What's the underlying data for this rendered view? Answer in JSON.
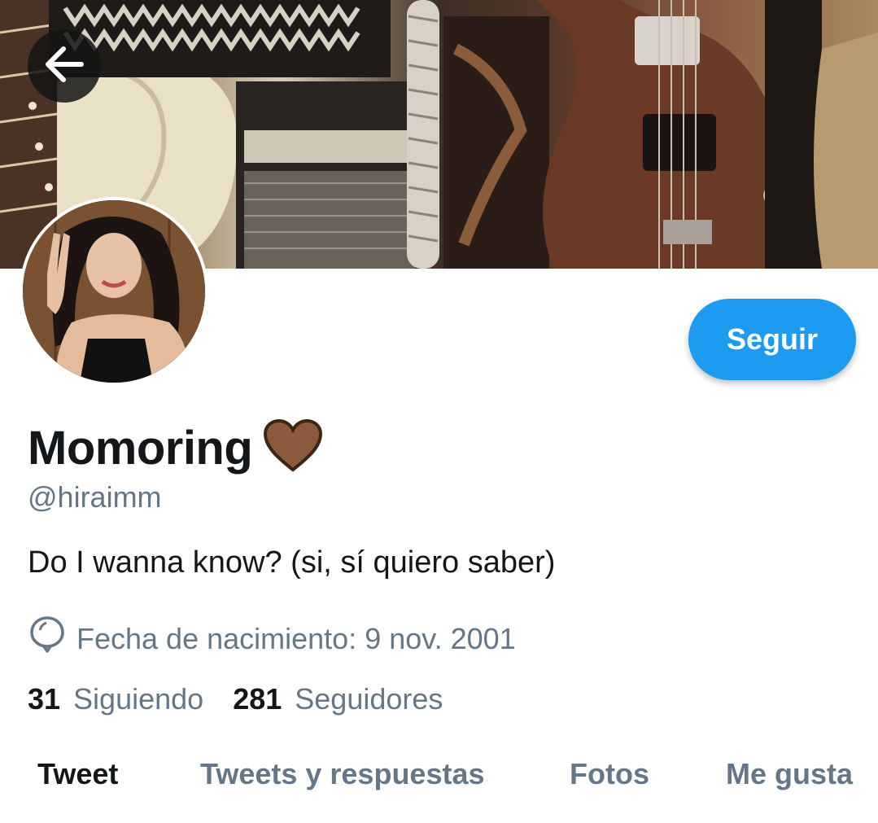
{
  "header": {
    "back_icon": "arrow-left-icon"
  },
  "profile": {
    "display_name": "Momoring",
    "name_emoji_icon": "brown-heart-icon",
    "handle": "@hiraimm",
    "bio": "Do I wanna know? (si, sí quiero saber)",
    "birth_icon": "balloon-icon",
    "birth_text": "Fecha de nacimiento: 9 nov. 2001",
    "follow_label": "Seguir"
  },
  "stats": {
    "following_count": "31",
    "following_label": "Siguiendo",
    "followers_count": "281",
    "followers_label": "Seguidores"
  },
  "tabs": [
    {
      "label": "Tweet",
      "active": true
    },
    {
      "label": "Tweets y respuestas",
      "active": false
    },
    {
      "label": "Fotos",
      "active": false
    },
    {
      "label": "Me gusta",
      "active": false
    }
  ],
  "colors": {
    "accent": "#1d9bf0",
    "secondary_text": "#657786",
    "heart": "#8b5a3c"
  }
}
